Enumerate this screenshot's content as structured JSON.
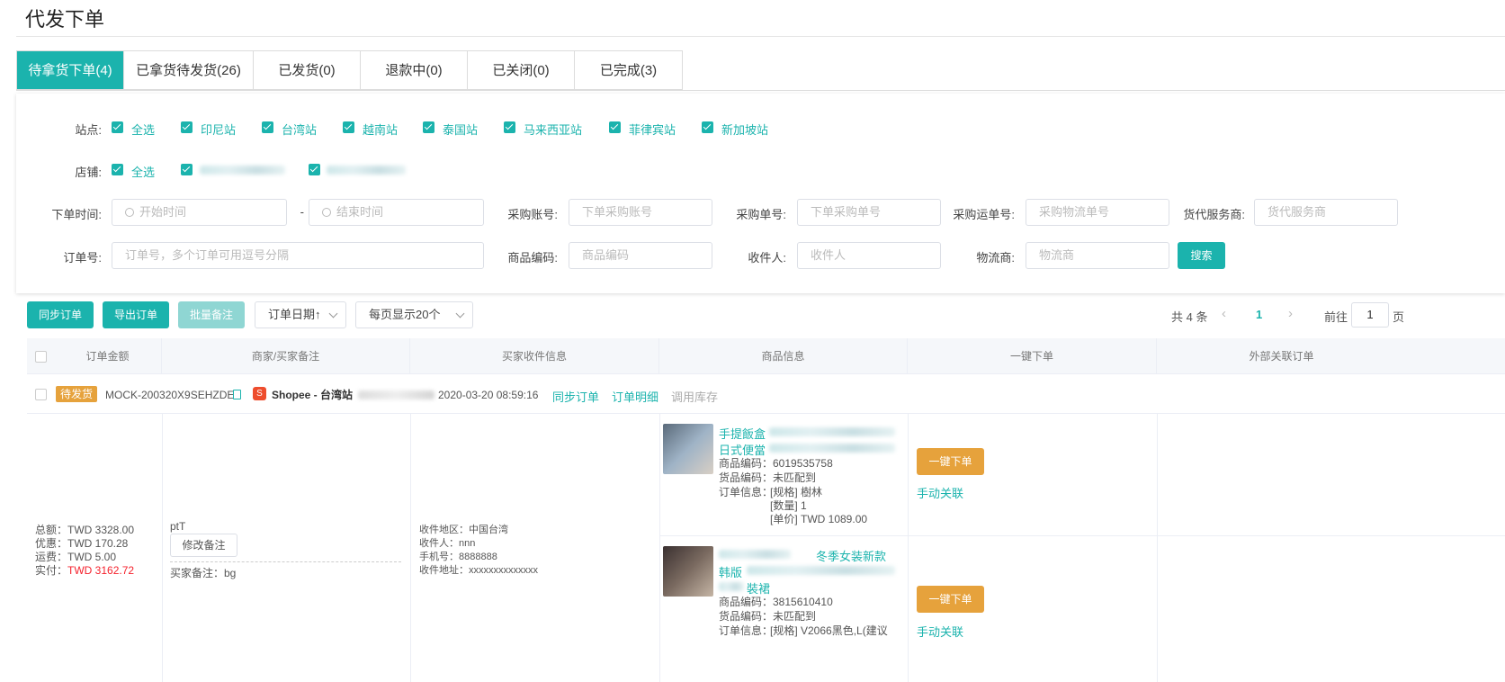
{
  "page_title": "代发下单",
  "tabs": [
    {
      "label": "待拿货下单(4)",
      "active": true
    },
    {
      "label": "已拿货待发货(26)",
      "active": false
    },
    {
      "label": "已发货(0)",
      "active": false
    },
    {
      "label": "退款中(0)",
      "active": false
    },
    {
      "label": "已关闭(0)",
      "active": false
    },
    {
      "label": "已完成(3)",
      "active": false
    }
  ],
  "filters": {
    "site_label": "站点:",
    "sites": [
      "全选",
      "印尼站",
      "台湾站",
      "越南站",
      "泰国站",
      "马来西亚站",
      "菲律宾站",
      "新加坡站"
    ],
    "shop_label": "店铺:",
    "shop_all": "全选",
    "order_time_label": "下单时间:",
    "start_time_placeholder": "开始时间",
    "end_time_placeholder": "结束时间",
    "range_sep": "-",
    "purchase_account_label": "采购账号:",
    "purchase_account_placeholder": "下单采购账号",
    "purchase_no_label": "采购单号:",
    "purchase_no_placeholder": "下单采购单号",
    "purchase_tracking_label": "采购运单号:",
    "purchase_tracking_placeholder": "采购物流单号",
    "forwarder_label": "货代服务商:",
    "forwarder_placeholder": "货代服务商",
    "order_no_label": "订单号:",
    "order_no_placeholder": "订单号，多个订单可用逗号分隔",
    "product_code_label": "商品编码:",
    "product_code_placeholder": "商品编码",
    "receiver_label": "收件人:",
    "receiver_placeholder": "收件人",
    "logistics_label": "物流商:",
    "logistics_placeholder": "物流商",
    "search_button": "搜索"
  },
  "toolbar": {
    "sync_button": "同步订单",
    "export_button": "导出订单",
    "batch_note_button": "批量备注",
    "sort_select": "订单日期↑",
    "page_size_select": "每页显示20个"
  },
  "pagination": {
    "total": "共 4 条",
    "current_page": "1",
    "goto_label": "前往",
    "goto_value": "1",
    "page_unit": "页"
  },
  "table": {
    "headers": [
      "订单金额",
      "商家/买家备注",
      "买家收件信息",
      "商品信息",
      "一键下单",
      "外部关联订单"
    ],
    "order": {
      "status_badge": "待发货",
      "order_id": "MOCK-200320X9SEHZDE",
      "platform": "Shopee - 台湾站",
      "time": "2020-03-20 08:59:16",
      "sync_link": "同步订单",
      "detail_link": "订单明细",
      "stock_link": "调用库存",
      "amounts": {
        "total": "总额：TWD 3328.00",
        "discount": "优惠：TWD 170.28",
        "shipping": "运费：TWD 5.00",
        "paid_label": "实付：",
        "paid_value": "TWD 3162.72"
      },
      "seller_note": "ptT",
      "edit_note_button": "修改备注",
      "buyer_note": "买家备注：bg",
      "recipient": {
        "region": "收件地区：中国台湾",
        "name": "收件人：nnn",
        "phone": "手机号：8888888",
        "address": "收件地址：xxxxxxxxxxxxxx"
      },
      "products": [
        {
          "title_line1": "手提飯盒",
          "title_line2": "日式便當",
          "code": "商品编码：6019535758",
          "match": "货品编码：未匹配到",
          "info_label": "订单信息：",
          "spec": "[规格] 樹林",
          "qty": "[数量] 1",
          "price": "[单价] TWD 1089.00",
          "quick_order": "一键下单",
          "manual_link": "手动关联"
        },
        {
          "title_line1": "冬季女装新款",
          "title_line2": "韩版",
          "title_line3": "裝裙",
          "code": "商品编码：3815610410",
          "match": "货品编码：未匹配到",
          "info_label": "订单信息：",
          "spec": "[规格] V2066黑色,L(建议",
          "quick_order": "一键下单",
          "manual_link": "手动关联"
        }
      ]
    }
  },
  "colors": {
    "accent": "#1bb3ad",
    "orange": "#e6a23c",
    "red": "#f5222d"
  }
}
